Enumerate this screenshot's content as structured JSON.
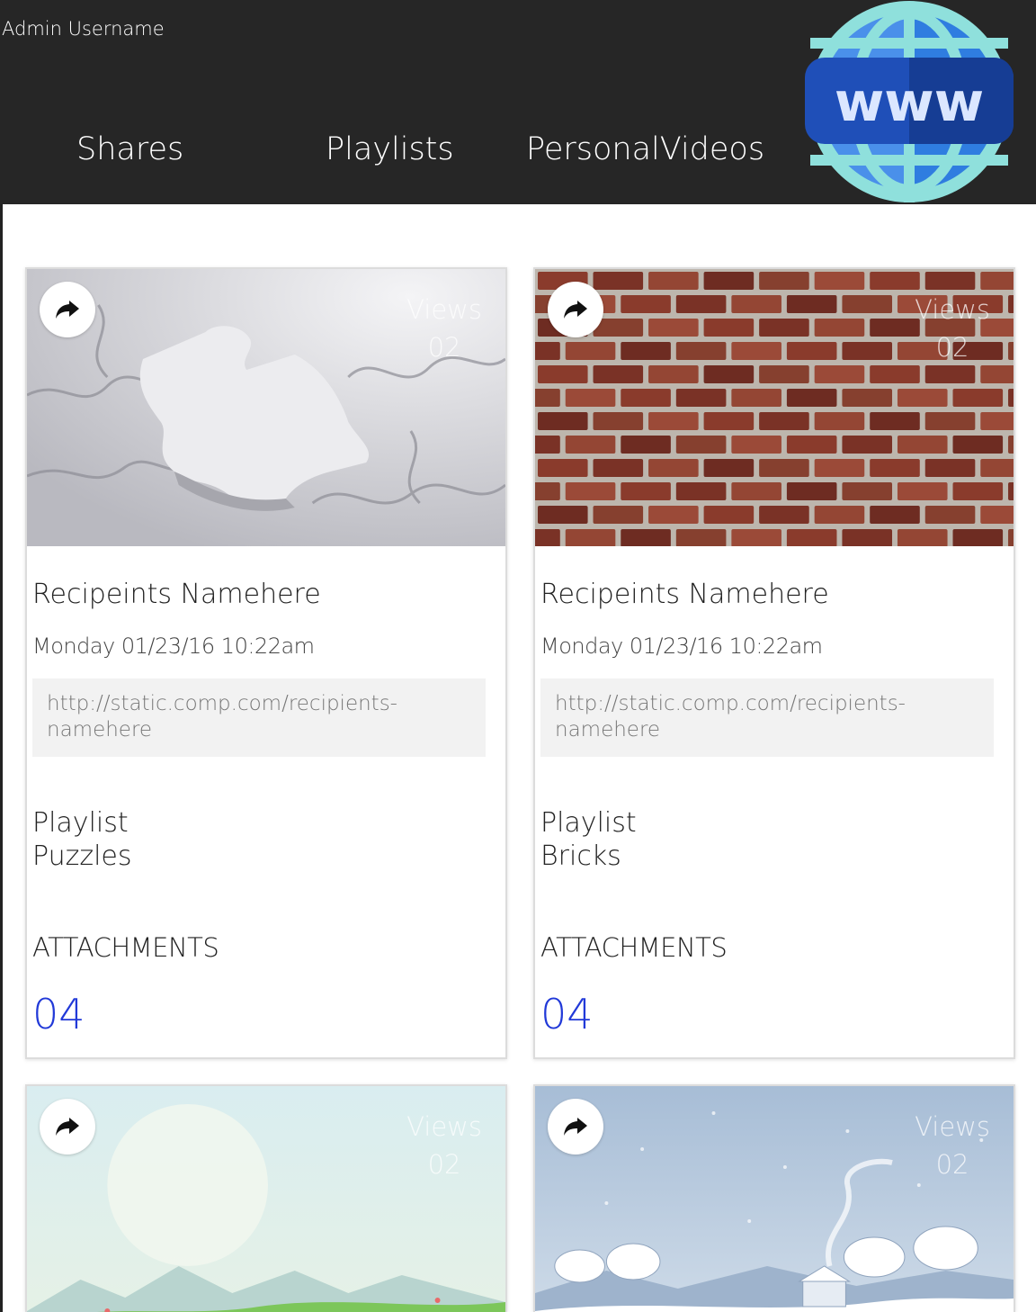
{
  "header": {
    "admin_username": "Admin Username",
    "nav": [
      "Shares",
      "Playlists",
      "PersonalVideos"
    ],
    "logo_text": "www",
    "logo_icon": "globe-www-icon"
  },
  "cards": [
    {
      "thumbnail": "puzzle-pieces",
      "views_label": "Views",
      "views_count": "02",
      "recipient": "Recipeints Namehere",
      "date": "Monday 01/23/16 10:22am",
      "url": "http://static.comp.com/recipients-namehere",
      "playlist_label": "Playlist",
      "playlist_name": "Puzzles",
      "attachments_label": "ATTACHMENTS",
      "attachments_count": "04"
    },
    {
      "thumbnail": "brick-wall",
      "views_label": "Views",
      "views_count": "02",
      "recipient": "Recipeints Namehere",
      "date": "Monday 01/23/16 10:22am",
      "url": "http://static.comp.com/recipients-namehere",
      "playlist_label": "Playlist",
      "playlist_name": "Bricks",
      "attachments_label": "ATTACHMENTS",
      "attachments_count": "04"
    },
    {
      "thumbnail": "spring-landscape",
      "views_label": "Views",
      "views_count": "02"
    },
    {
      "thumbnail": "winter-landscape",
      "views_label": "Views",
      "views_count": "02"
    }
  ],
  "colors": {
    "header_bg": "#262626",
    "accent_count": "#2139d8",
    "url_bg": "#f2f2f2"
  }
}
